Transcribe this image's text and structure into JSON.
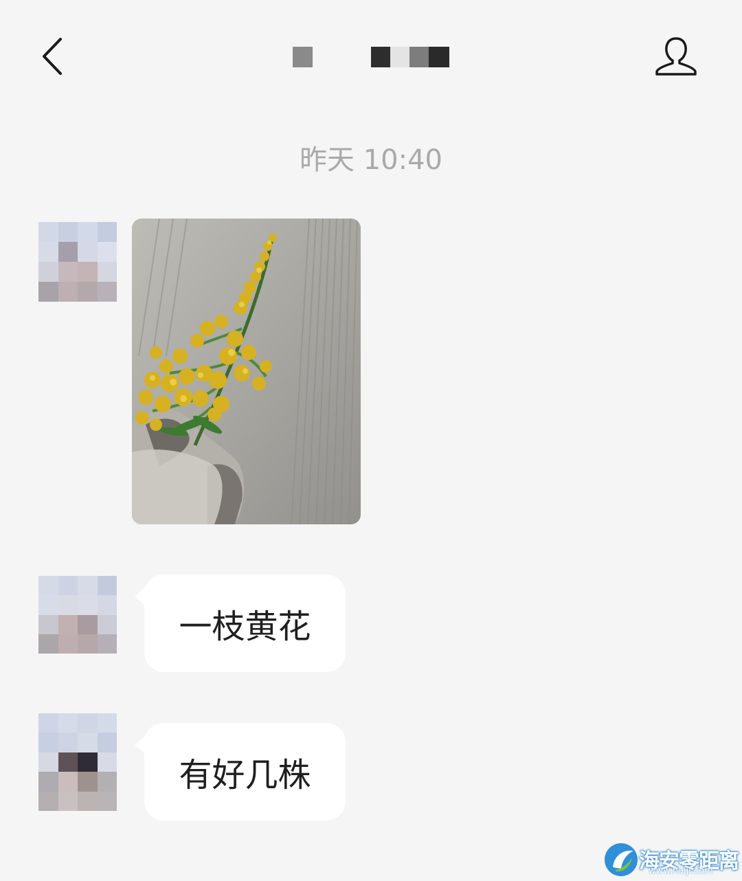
{
  "header": {
    "back_icon": "chevron-left-icon",
    "profile_icon": "person-outline-icon",
    "title_redacted": true
  },
  "chat": {
    "timestamp": "昨天 10:40",
    "messages": [
      {
        "type": "image",
        "description_icon": "photo-yellow-flower"
      },
      {
        "type": "text",
        "text": "一枝黄花"
      },
      {
        "type": "text",
        "text": "有好几株"
      }
    ]
  },
  "watermark": {
    "brand": "海安零距离",
    "url": "www.haiji.com"
  },
  "colors": {
    "background": "#f4f5f4",
    "bubble": "#ffffff",
    "timestamp": "#a9a9a9",
    "text": "#1f1f1f"
  }
}
